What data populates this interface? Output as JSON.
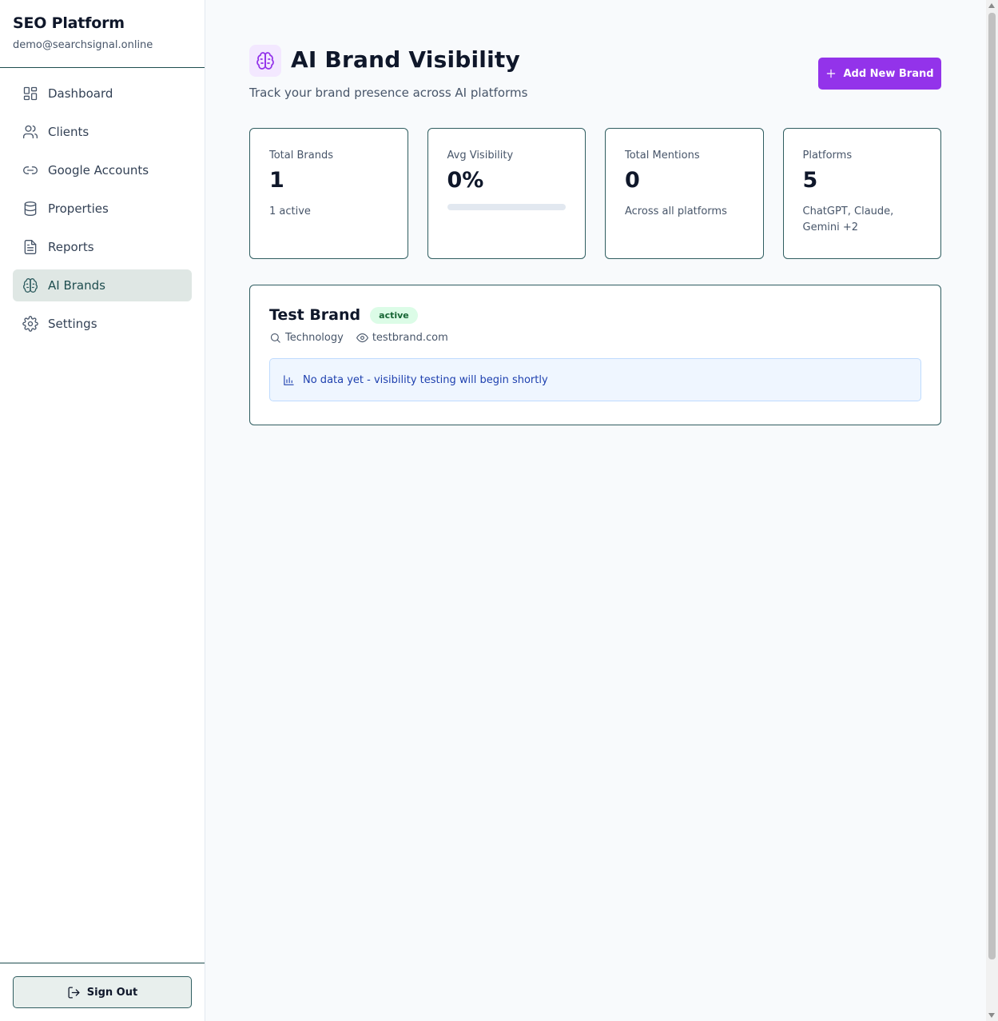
{
  "sidebar": {
    "app_title": "SEO Platform",
    "user_email": "demo@searchsignal.online",
    "items": [
      {
        "label": "Dashboard",
        "icon": "dashboard-icon"
      },
      {
        "label": "Clients",
        "icon": "users-icon"
      },
      {
        "label": "Google Accounts",
        "icon": "link-icon"
      },
      {
        "label": "Properties",
        "icon": "database-icon"
      },
      {
        "label": "Reports",
        "icon": "file-text-icon"
      },
      {
        "label": "AI Brands",
        "icon": "brain-icon",
        "active": true
      },
      {
        "label": "Settings",
        "icon": "gear-icon"
      }
    ],
    "sign_out_label": "Sign Out"
  },
  "header": {
    "title": "AI Brand Visibility",
    "subtitle": "Track your brand presence across AI platforms",
    "icon": "brain-icon",
    "add_button_label": "Add New Brand"
  },
  "stats": [
    {
      "label": "Total Brands",
      "value": "1",
      "sub": "1 active"
    },
    {
      "label": "Avg Visibility",
      "value": "0%",
      "progress": 0
    },
    {
      "label": "Total Mentions",
      "value": "0",
      "sub": "Across all platforms"
    },
    {
      "label": "Platforms",
      "value": "5",
      "sub": "ChatGPT, Claude, Gemini +2"
    }
  ],
  "brand": {
    "name": "Test Brand",
    "status": "active",
    "category": "Technology",
    "domain": "testbrand.com",
    "notice": "No data yet - visibility testing will begin shortly"
  },
  "colors": {
    "accent": "#9333ea",
    "sidebar_active": "#dfe7e4",
    "border": "#2f5d60",
    "badge_bg": "#dcfce7",
    "notice_bg": "#eff6ff"
  }
}
